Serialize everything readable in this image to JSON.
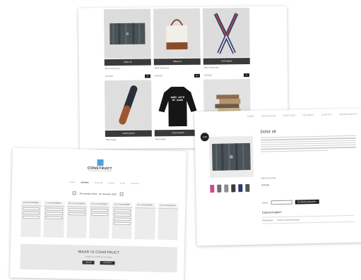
{
  "productGrid": {
    "products": [
      {
        "name": "Dolor sit",
        "meta": "Merk Samsung",
        "price": "€379,00"
      },
      {
        "name": "Officia ut",
        "meta": "Merk Samsung",
        "price": "€549,00"
      },
      {
        "name": "Sunt aliqua",
        "meta": "Merk Samsung",
        "price": "€129,00"
      },
      {
        "name": "Lorem ipsum",
        "meta": "Merk Apple",
        "price": ""
      },
      {
        "name": "Lorem ipsum",
        "meta": "Merk Apple",
        "price": ""
      },
      {
        "name": "",
        "meta": "",
        "price": ""
      }
    ],
    "shirtText": "DOES WITH MY HAND"
  },
  "detail": {
    "nav": [
      "HOME",
      "PRODUCTEN",
      "OVER ONS",
      "TECHNIEK",
      "CONTACT",
      "WINKELWAGEN"
    ],
    "badge": "-20%",
    "title": "Dolor sit",
    "brand": "Merk Samsung",
    "price": "€379,00",
    "quantityLabel": "Aantal",
    "addButton": "IN WINKELWAGEN",
    "specTitle": "Eigenschappen",
    "specLabel": "Afmetingen",
    "specValue": "Sed do eiusmod tempor"
  },
  "home": {
    "logoText": "CONSTRUCT",
    "logoSub": "THE WORKSPACE FOR CREATORS",
    "nav": [
      "HOME",
      "AGENDA",
      "RUIMTES",
      "LEDEN",
      "BLOG",
      "CONTACT"
    ],
    "activeNav": "AGENDA",
    "week": "18 november 2019 - 24 november 2019",
    "days": [
      "MA 18 NOVEMBER",
      "DI 19 NOVEMBER",
      "WO 20 NOVEMBER",
      "DO 21 NOVEMBER",
      "VR 22 NOVEMBER",
      "ZA 23 NOVEMBER",
      "ZO 24 NOVEMBER"
    ],
    "promoTitle": "WAAR IS CONSTRUCT",
    "promoSub": "Bekijk onze locatie en kom langs",
    "promoButtons": [
      "ROUTE",
      "CONTACT"
    ]
  },
  "colors": {
    "accent": "#4aa3df",
    "dark": "#2b2b2b"
  }
}
